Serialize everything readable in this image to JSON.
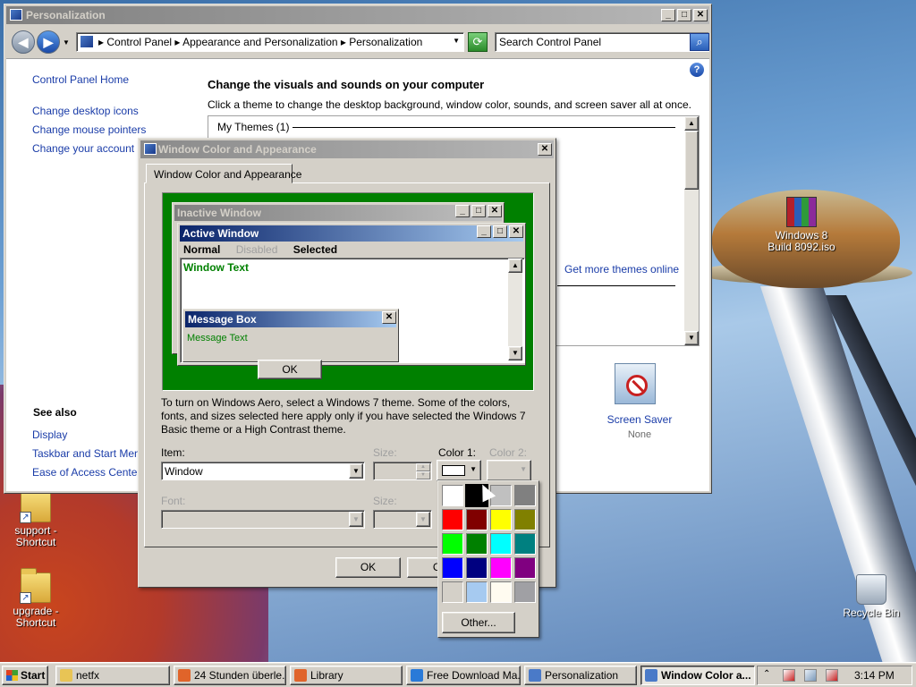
{
  "desktop": {
    "icons": [
      {
        "id": "support",
        "label": "support -\nShortcut"
      },
      {
        "id": "upgrade",
        "label": "upgrade -\nShortcut"
      },
      {
        "id": "winrar",
        "label": "Windows 8\nBuild 8092.iso"
      },
      {
        "id": "recycle",
        "label": "Recycle Bin"
      }
    ]
  },
  "personalization": {
    "title": "Personalization",
    "breadcrumbs": "▸  Control Panel  ▸  Appearance and Personalization  ▸  Personalization",
    "search_placeholder": "Search Control Panel",
    "left_links": [
      "Control Panel Home",
      "Change desktop icons",
      "Change mouse pointers",
      "Change your account picture"
    ],
    "see_also": "See also",
    "see_also_links": [
      "Display",
      "Taskbar and Start Menu",
      "Ease of Access Center"
    ],
    "heading": "Change the visuals and sounds on your computer",
    "subheading": "Click a theme to change the desktop background, window color, sounds, and screen saver all at once.",
    "my_themes": "My Themes (1)",
    "more_themes": "Get more themes online",
    "screen_saver_label": "Screen Saver",
    "screen_saver_value": "None"
  },
  "wca": {
    "title": "Window Color and Appearance",
    "tab": "Window Color and Appearance",
    "preview": {
      "inactive_title": "Inactive Window",
      "active_title": "Active Window",
      "menu_normal": "Normal",
      "menu_disabled": "Disabled",
      "menu_selected": "Selected",
      "window_text": "Window Text",
      "msgbox_title": "Message Box",
      "msgbox_text": "Message Text",
      "msgbox_ok": "OK"
    },
    "aero_note": "To turn on Windows Aero, select a Windows 7 theme.  Some of the colors, fonts, and sizes selected here apply only if you have selected the Windows 7 Basic theme or a High Contrast theme.",
    "item_label": "Item:",
    "item_value": "Window",
    "size_label": "Size:",
    "color1_label": "Color 1:",
    "color2_label": "Color 2:",
    "font_label": "Font:",
    "font_size_label": "Size:",
    "ok": "OK",
    "cancel": "Ca"
  },
  "picker": {
    "colors": [
      "#ffffff",
      "#000000",
      "#c0c0c0",
      "#808080",
      "#ff0000",
      "#800000",
      "#ffff00",
      "#808000",
      "#00ff00",
      "#008000",
      "#00ffff",
      "#008080",
      "#0000ff",
      "#000080",
      "#ff00ff",
      "#800080",
      "#d4d0c8",
      "#a6caf0",
      "#fffbf0",
      "#a0a0a4"
    ],
    "selected_index": 1,
    "other": "Other..."
  },
  "taskbar": {
    "start": "Start",
    "tasks": [
      {
        "label": "netfx",
        "color": "#e8c455"
      },
      {
        "label": "24 Stunden überle...",
        "color": "#e0642a"
      },
      {
        "label": "Library",
        "color": "#e0642a"
      },
      {
        "label": "Free Download Ma...",
        "color": "#2a7ad8"
      },
      {
        "label": "Personalization",
        "color": "#4a7ac8"
      },
      {
        "label": "Window Color a...",
        "color": "#4a7ac8"
      }
    ],
    "clock": "3:14 PM"
  }
}
